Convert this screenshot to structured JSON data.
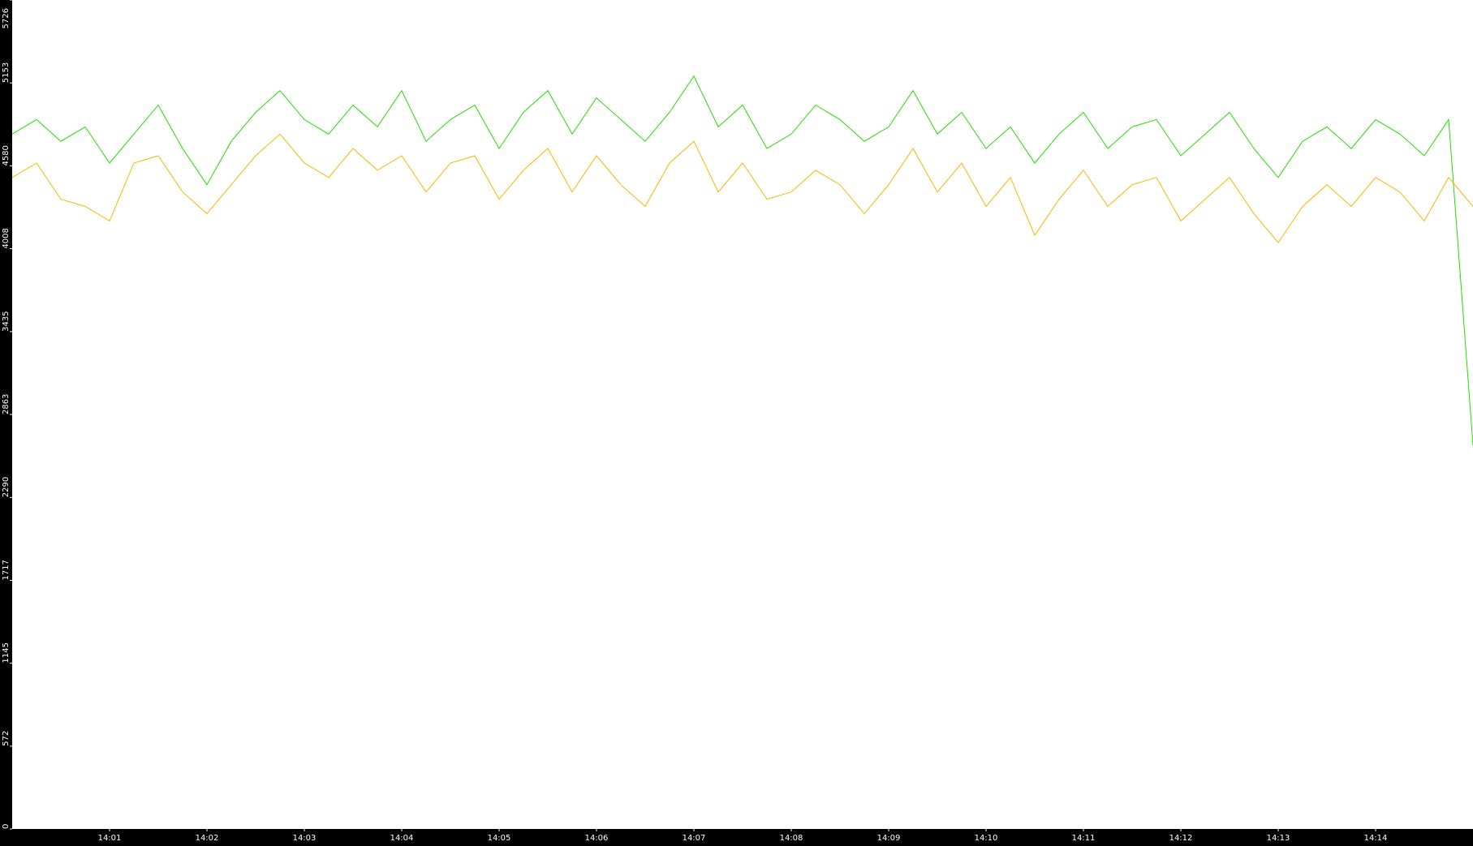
{
  "chart_data": {
    "type": "line",
    "title": "",
    "xlabel": "",
    "ylabel": "",
    "ylim": [
      0,
      5726
    ],
    "y_ticks": [
      0,
      572,
      1145,
      1717,
      2290,
      2863,
      3435,
      4008,
      4580,
      5153,
      5726
    ],
    "y_tick_labels": [
      "0",
      "572",
      "1145",
      "1717",
      "2290",
      "2863",
      "3435",
      "4008",
      "4580",
      "5153",
      "5726"
    ],
    "x_range": [
      "14:00:00",
      "14:15:00"
    ],
    "x_ticks": [
      "14:01",
      "14:02",
      "14:03",
      "14:04",
      "14:05",
      "14:06",
      "14:07",
      "14:08",
      "14:09",
      "14:10",
      "14:11",
      "14:12",
      "14:13",
      "14:14"
    ],
    "grid": false,
    "background": "#ffffff",
    "axis_background": "#000000",
    "axis_text_color": "#ffffff",
    "series": [
      {
        "color": "#22dd00",
        "x_start": "14:00:00",
        "x_step_seconds": 15,
        "values": [
          4800,
          4900,
          4750,
          4850,
          4600,
          4800,
          5000,
          4700,
          4450,
          4750,
          4950,
          5100,
          4900,
          4800,
          5000,
          4850,
          5100,
          4750,
          4900,
          5000,
          4700,
          4950,
          5100,
          4800,
          5050,
          4900,
          4750,
          4950,
          5200,
          4850,
          5000,
          4700,
          4800,
          5000,
          4900,
          4750,
          4850,
          5100,
          4800,
          4950,
          4700,
          4850,
          4600,
          4800,
          4950,
          4700,
          4850,
          4900,
          4650,
          4800,
          4950,
          4700,
          4500,
          4750,
          4850,
          4700,
          4900,
          4800,
          4650,
          4900,
          2650
        ]
      },
      {
        "color": "#f5b800",
        "x_start": "14:00:00",
        "x_step_seconds": 15,
        "values": [
          4500,
          4600,
          4350,
          4300,
          4200,
          4600,
          4650,
          4400,
          4250,
          4450,
          4650,
          4800,
          4600,
          4500,
          4700,
          4550,
          4650,
          4400,
          4600,
          4650,
          4350,
          4550,
          4700,
          4400,
          4650,
          4450,
          4300,
          4600,
          4750,
          4400,
          4600,
          4350,
          4400,
          4550,
          4450,
          4250,
          4450,
          4700,
          4400,
          4600,
          4300,
          4500,
          4100,
          4350,
          4550,
          4300,
          4450,
          4500,
          4200,
          4350,
          4500,
          4250,
          4050,
          4300,
          4450,
          4300,
          4500,
          4400,
          4200,
          4500,
          4300
        ]
      }
    ]
  }
}
